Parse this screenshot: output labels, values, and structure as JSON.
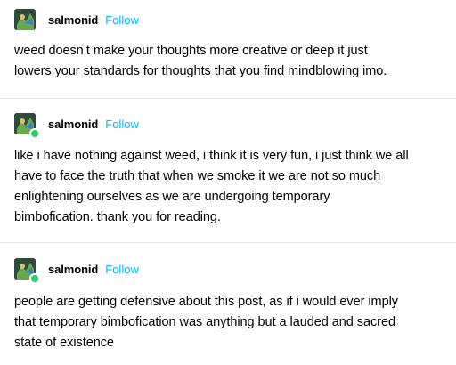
{
  "posts": [
    {
      "username": "salmonid",
      "follow_label": "Follow",
      "has_badge": false,
      "lines": [
        "weed doesn’t make your thoughts more creative or deep it just",
        "lowers your standards for thoughts that you find mindblowing imo."
      ]
    },
    {
      "username": "salmonid",
      "follow_label": "Follow",
      "has_badge": true,
      "lines": [
        "like i have nothing against weed, i think it is very fun, i just think we all",
        "have to face the truth that when we smoke it we are not so much",
        "enlightening ourselves as we are undergoing temporary",
        "bimbofication. thank you for reading."
      ]
    },
    {
      "username": "salmonid",
      "follow_label": "Follow",
      "has_badge": true,
      "lines": [
        "people are getting defensive about this post, as if i would ever imply",
        "that temporary bimbofication was anything but a lauded and sacred",
        "state of existence"
      ]
    }
  ],
  "colors": {
    "follow": "#00b8ff",
    "badge": "#2ecc71",
    "divider": "#e3e3e3"
  },
  "icons": {
    "avatar": "profile-avatar-icon",
    "badge": "green-status-badge-icon"
  }
}
